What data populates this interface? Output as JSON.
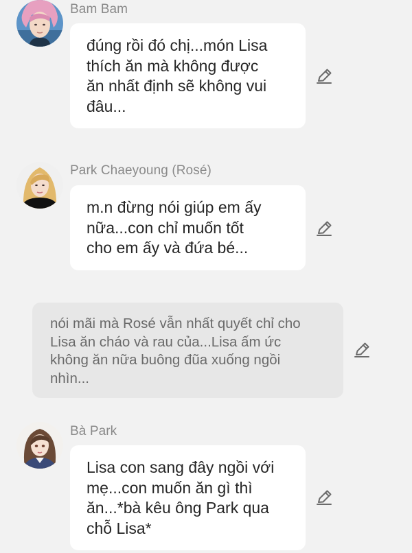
{
  "messages": [
    {
      "sender": "Bam Bam",
      "avatar_icon": "bambam-avatar",
      "lines": [
        "đúng rồi đó chị...món Lisa",
        "thích ăn mà không được",
        "ăn nhất định sẽ không vui",
        "đâu..."
      ]
    },
    {
      "sender": "Park Chaeyoung (Rosé)",
      "avatar_icon": "rose-avatar",
      "lines": [
        "m.n đừng nói giúp em ấy",
        "nữa...con chỉ muốn tốt",
        "cho em ấy và đứa bé..."
      ]
    },
    {
      "narration": true,
      "lines": [
        "nói mãi mà Rosé vẫn nhất quyết chỉ cho",
        "Lisa ăn cháo và rau của...Lisa ấm ức",
        "không ăn nữa buông đũa xuống ngồi",
        "nhìn..."
      ]
    },
    {
      "sender": "Bà Park",
      "avatar_icon": "ba-park-avatar",
      "lines": [
        "Lisa con sang đây ngồi với",
        "mẹ...con muốn ăn gì thì",
        "ăn...*bà kêu ông Park qua",
        "chỗ Lisa*"
      ]
    }
  ],
  "icons": {
    "edit": "pencil-icon"
  },
  "colors": {
    "background": "#f2f2f2",
    "bubble": "#ffffff",
    "narration_bubble": "#e7e7e7",
    "sender_text": "#8a8a8a",
    "message_text": "#262626",
    "narration_text": "#6a6a6a",
    "edit_icon": "#6b6b6b"
  }
}
